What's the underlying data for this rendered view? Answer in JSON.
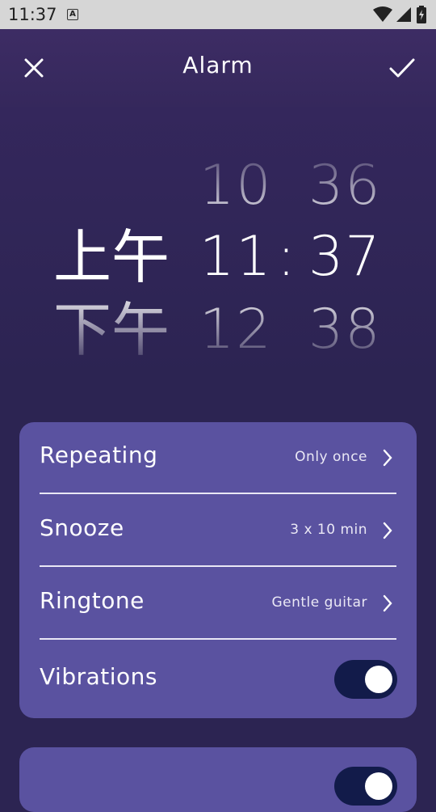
{
  "status_bar": {
    "time": "11:37",
    "notification_icon": "a-notification-icon",
    "wifi_icon": "wifi-icon",
    "signal_icon": "signal-icon",
    "battery_icon": "battery-icon"
  },
  "header": {
    "title": "Alarm",
    "close_icon": "close-icon",
    "confirm_icon": "check-icon"
  },
  "picker": {
    "ampm": {
      "selected": "上午",
      "next": "下午"
    },
    "hours": {
      "prev": "10",
      "selected": "11",
      "next": "12"
    },
    "minutes": {
      "prev": "36",
      "selected": "37",
      "next": "38"
    },
    "separator": ":"
  },
  "settings": {
    "repeating": {
      "label": "Repeating",
      "value": "Only once"
    },
    "snooze": {
      "label": "Snooze",
      "value": "3 x 10 min"
    },
    "ringtone": {
      "label": "Ringtone",
      "value": "Gentle guitar"
    },
    "vibrations": {
      "label": "Vibrations",
      "enabled": true
    }
  },
  "second_card": {
    "toggle_enabled": true
  },
  "colors": {
    "background": "#2c2452",
    "card": "#5a52a0",
    "toggle_track": "#121b4a",
    "status_bar": "#d6d6d6"
  }
}
